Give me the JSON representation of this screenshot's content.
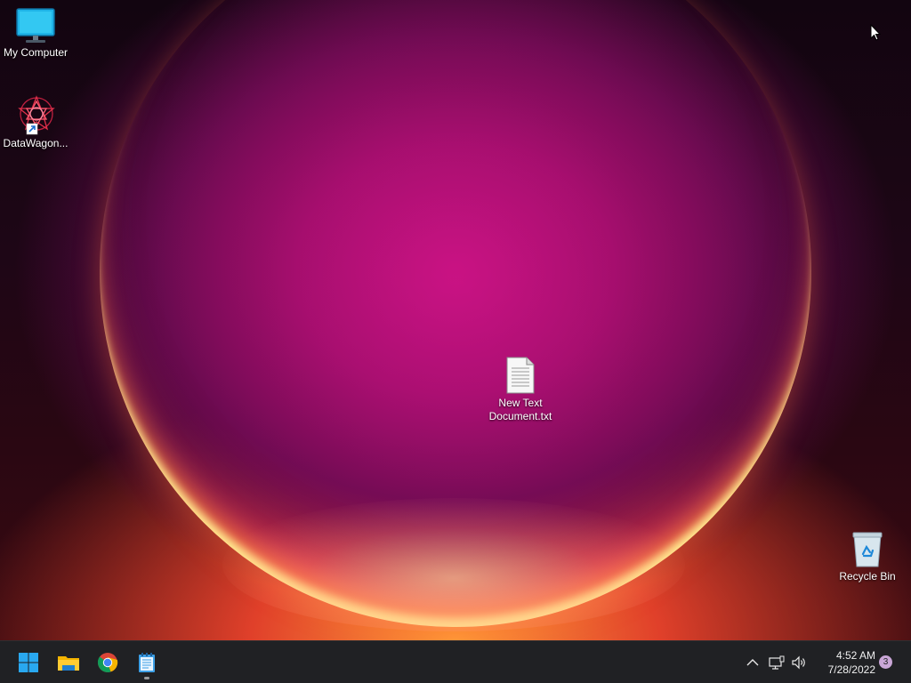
{
  "desktop": {
    "icons": [
      {
        "label": "My Computer",
        "icon": "monitor-icon"
      },
      {
        "label": "DataWagon...",
        "icon": "datawagon-shortcut-icon"
      },
      {
        "label": "New Text Document.txt",
        "label_line1": "New Text",
        "label_line2": "Document.txt",
        "icon": "text-document-icon"
      },
      {
        "label": "Recycle Bin",
        "icon": "recycle-bin-icon"
      }
    ]
  },
  "taskbar": {
    "apps": [
      {
        "name": "Start",
        "icon": "windows-start-icon"
      },
      {
        "name": "File Explorer",
        "icon": "folder-icon"
      },
      {
        "name": "Google Chrome",
        "icon": "chrome-icon"
      },
      {
        "name": "Notepad",
        "icon": "notepad-icon",
        "active": true
      }
    ],
    "tray": {
      "icons": [
        "chevron-up-icon",
        "network-icon",
        "volume-icon"
      ],
      "time": "4:52 AM",
      "date": "7/28/2022",
      "notification_count": "3"
    }
  },
  "colors": {
    "taskbar_bg": "#202124",
    "accent_blue": "#0a84d6"
  }
}
